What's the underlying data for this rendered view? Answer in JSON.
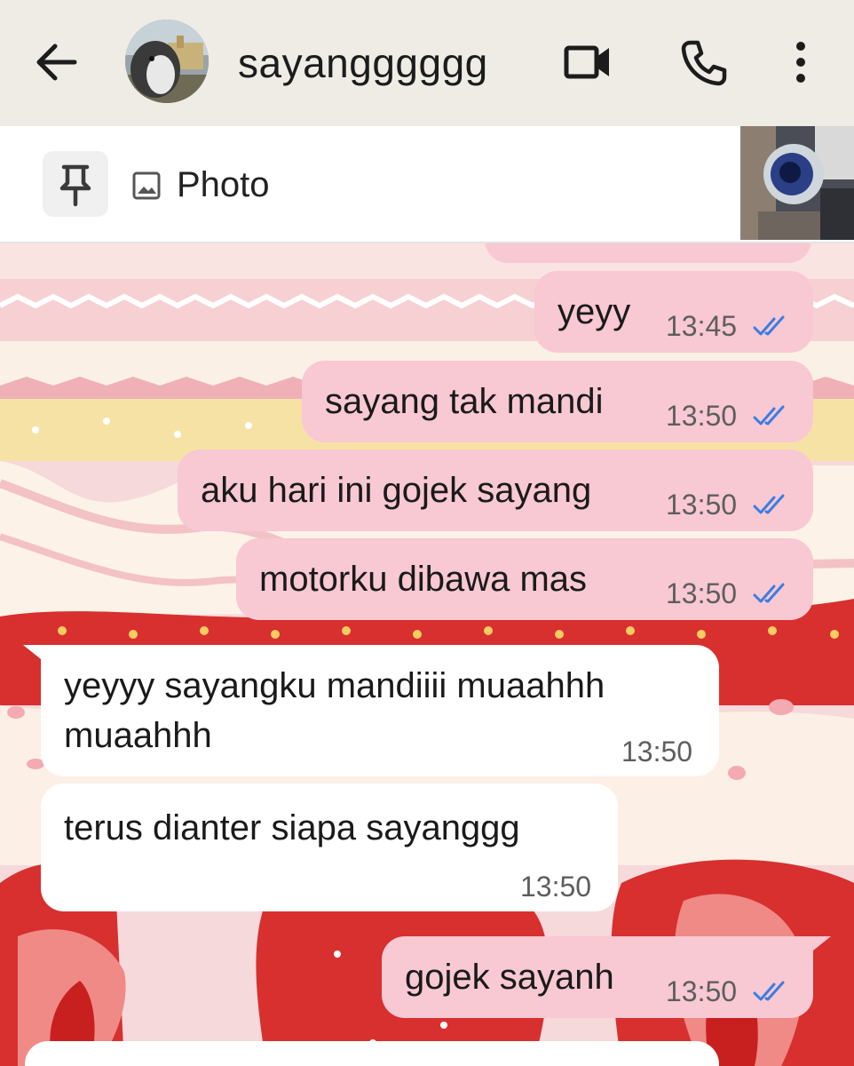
{
  "header": {
    "contact_name": "sayangggggg",
    "icons": [
      "back-arrow-icon",
      "avatar",
      "video-call-icon",
      "phone-call-icon",
      "more-options-icon"
    ]
  },
  "pinned": {
    "label": "Photo",
    "icons": [
      "pin-icon",
      "image-icon"
    ]
  },
  "messages": [
    {
      "direction": "out",
      "text": "yeyy",
      "time": "13:45",
      "status": "read"
    },
    {
      "direction": "out",
      "text": "sayang tak mandi",
      "time": "13:50",
      "status": "read"
    },
    {
      "direction": "out",
      "text": "aku hari ini gojek sayang",
      "time": "13:50",
      "status": "read"
    },
    {
      "direction": "out",
      "text": "motorku dibawa mas",
      "time": "13:50",
      "status": "read"
    },
    {
      "direction": "in",
      "text_line1": "yeyyy sayangku mandiiii muaahhh",
      "text_line2": "muaahhh",
      "time": "13:50"
    },
    {
      "direction": "in",
      "text": "terus dianter siapa sayanggg",
      "time": "13:50"
    },
    {
      "direction": "out",
      "text": "gojek sayanh",
      "time": "13:50",
      "status": "read"
    }
  ],
  "colors": {
    "header_bg": "#efece6",
    "outgoing_bubble": "#f8c8d3",
    "incoming_bubble": "#ffffff",
    "read_ticks": "#3b7de0",
    "wallpaper_red": "#d7302f",
    "wallpaper_pink": "#f6d9db"
  }
}
